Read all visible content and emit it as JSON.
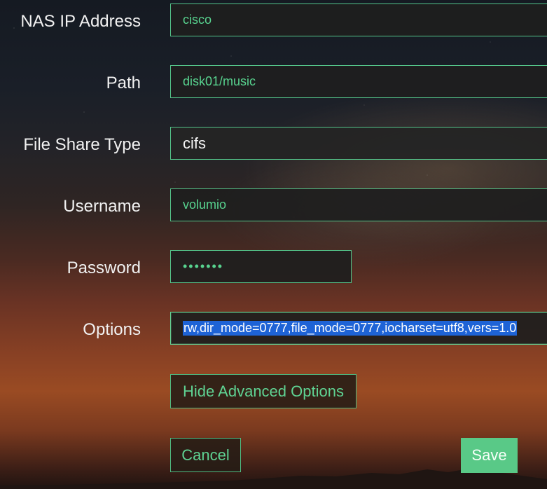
{
  "form": {
    "fields": [
      {
        "label": "NAS IP Address",
        "value": "cisco"
      },
      {
        "label": "Path",
        "value": "disk01/music"
      },
      {
        "label": "File Share Type",
        "value": "cifs"
      },
      {
        "label": "Username",
        "value": "volumio"
      },
      {
        "label": "Password",
        "value": "•••••••"
      },
      {
        "label": "Options",
        "value": "rw,dir_mode=0777,file_mode=0777,iocharset=utf8,vers=1.0"
      }
    ],
    "buttons": {
      "hide_advanced": "Hide Advanced Options",
      "cancel": "Cancel",
      "save": "Save"
    }
  },
  "colors": {
    "accent": "#59c987",
    "field_text": "#58d38f",
    "selection": "#1e63d6"
  }
}
